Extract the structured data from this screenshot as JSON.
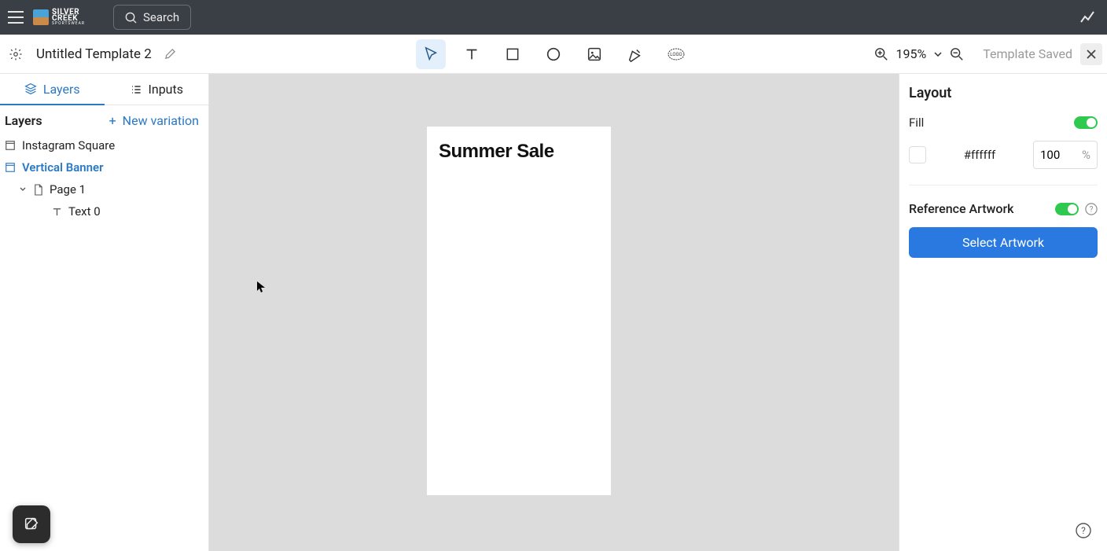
{
  "brand": {
    "line1": "SILVER",
    "line2": "CREEK",
    "line3": "SPORTSWEAR"
  },
  "search": {
    "label": "Search"
  },
  "template": {
    "name": "Untitled Template 2",
    "status": "Template Saved"
  },
  "zoom": {
    "label": "195%"
  },
  "tabs": {
    "layers": "Layers",
    "inputs": "Inputs"
  },
  "layers": {
    "title": "Layers",
    "new_variation": "New variation",
    "items": [
      {
        "label": "Instagram Square"
      },
      {
        "label": "Vertical Banner"
      },
      {
        "label": "Page 1"
      },
      {
        "label": "Text 0"
      }
    ]
  },
  "canvas": {
    "text": "Summer Sale"
  },
  "layout": {
    "title": "Layout",
    "fill_label": "Fill",
    "fill_hex": "#ffffff",
    "fill_opacity": "100",
    "pct": "%",
    "reference_label": "Reference Artwork",
    "select_btn": "Select Artwork"
  }
}
